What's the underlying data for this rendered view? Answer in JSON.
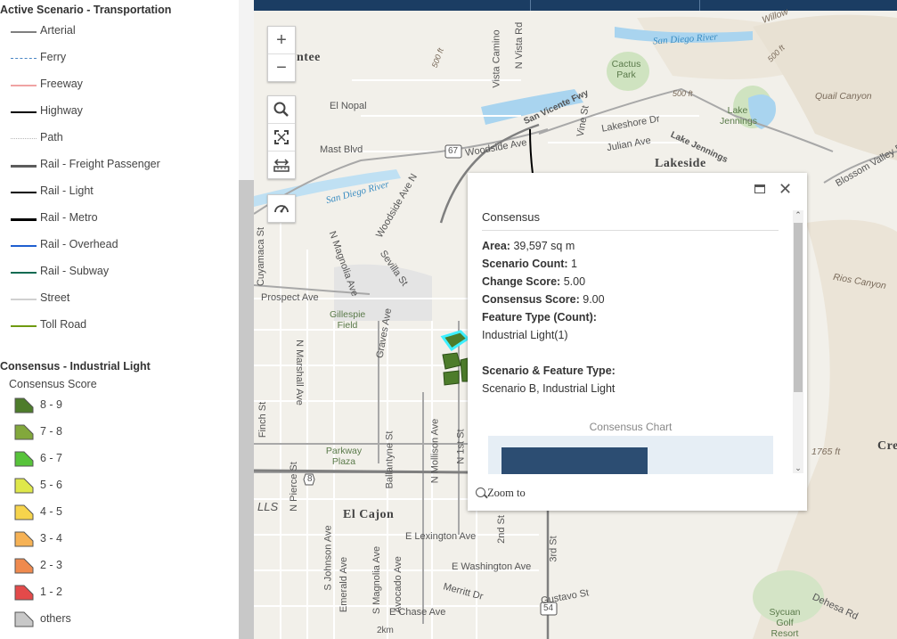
{
  "legend": {
    "transport_title": "Active Scenario - Transportation",
    "transport_items": [
      {
        "label": "Arterial",
        "color": "#7f7f7f",
        "style": "solid",
        "weight": 2
      },
      {
        "label": "Ferry",
        "color": "#4a86c5",
        "style": "dashed",
        "weight": 1.5
      },
      {
        "label": "Freeway",
        "color": "#f0a3a3",
        "style": "solid",
        "weight": 2
      },
      {
        "label": "Highway",
        "color": "#000000",
        "style": "solid",
        "weight": 2
      },
      {
        "label": "Path",
        "color": "#b7b7b7",
        "style": "dotted",
        "weight": 1.5
      },
      {
        "label": "Rail - Freight Passenger",
        "color": "#5c5c5c",
        "style": "solid",
        "weight": 3
      },
      {
        "label": "Rail - Light",
        "color": "#000000",
        "style": "solid",
        "weight": 2
      },
      {
        "label": "Rail - Metro",
        "color": "#000000",
        "style": "solid",
        "weight": 3
      },
      {
        "label": "Rail - Overhead",
        "color": "#1f5fd0",
        "style": "solid",
        "weight": 2
      },
      {
        "label": "Rail - Subway",
        "color": "#0e6b52",
        "style": "solid",
        "weight": 2
      },
      {
        "label": "Street",
        "color": "#d0d0d0",
        "style": "solid",
        "weight": 2
      },
      {
        "label": "Toll Road",
        "color": "#6f9a10",
        "style": "solid",
        "weight": 2
      }
    ],
    "consensus_title": "Consensus - Industrial Light",
    "consensus_subtitle": "Consensus Score",
    "consensus_items": [
      {
        "label": "8 - 9",
        "color": "#4d7c2b"
      },
      {
        "label": "7 - 8",
        "color": "#82a83c"
      },
      {
        "label": "6 - 7",
        "color": "#57c33a"
      },
      {
        "label": "5 - 6",
        "color": "#dfe84a"
      },
      {
        "label": "4 - 5",
        "color": "#f6d44c"
      },
      {
        "label": "3 - 4",
        "color": "#f6b255"
      },
      {
        "label": "2 - 3",
        "color": "#ef8a4e"
      },
      {
        "label": "1 - 2",
        "color": "#e34a4a"
      },
      {
        "label": "others",
        "color": "#c8c8c8"
      }
    ]
  },
  "map": {
    "controls": {
      "zoom_in": "+",
      "zoom_out": "−"
    },
    "labels": {
      "city_el_cajon": "El Cajon",
      "city_lakeside": "Lakeside",
      "city_santee_partial": "ntee",
      "city_cre_partial": "Cre",
      "water_san_diego_river_1": "San Diego River",
      "water_san_diego_river_2": "San Diego River",
      "park_cactus": "Cactus Park",
      "park_lake_jennings": "Lake Jennings",
      "park_gillespie": "Gillespie Field",
      "park_parkway_plaza": "Parkway Plaza",
      "park_sycuan": "Sycuan Golf Resort",
      "terrain_quail_canyon": "Quail Canyon",
      "terrain_rios_canyon": "Rios Canyon",
      "terrain_blossom_valley": "Blossom Valley Rd",
      "terrain_willow": "Willow",
      "terrain_1765": "1765 ft",
      "terrain_500_1": "500 ft",
      "terrain_500_2": "500 ft",
      "terrain_500_3": "500 ft",
      "street_el_nopal": "El Nopal",
      "street_mast": "Mast Blvd",
      "street_woodside": "Woodside Ave",
      "street_woodside_n": "Woodside Ave N",
      "street_lakeshore": "Lakeshore Dr",
      "street_julian": "Julian Ave",
      "street_san_vicente": "San Vicente Fwy",
      "street_lake_jennings": "Lake Jennings",
      "street_vista_camino": "Vista Camino",
      "street_n_vista": "N Vista Rd",
      "street_vine": "Vine St",
      "street_prospect": "Prospect Ave",
      "street_cuyamaca": "Cuyamaca St",
      "street_n_magnolia": "N Magnolia Ave",
      "street_sevilla": "Sevilla St",
      "street_graves": "Graves Ave",
      "street_n_marshall": "N Marshall Ave",
      "street_fincn": "Finch St",
      "street_n_pierce": "N Pierce St",
      "street_ballantyne": "Ballantyne St",
      "street_n_mollison": "N Mollison Ave",
      "street_n_1st": "N 1st St",
      "street_e_lexington": "E Lexington Ave",
      "street_e_washington": "E Washington Ave",
      "street_s_johnson": "S Johnson Ave",
      "street_emerald": "Emerald Ave",
      "street_s_magnolia": "S Magnolia Ave",
      "street_avocado": "Avocado Ave",
      "street_e_chase": "E Chase Ave",
      "street_merritt": "Merritt Dr",
      "street_gustavo": "Gustavo St",
      "street_2nd": "2nd St",
      "street_3rd": "3rd St",
      "street_dehesa": "Dehesa Rd",
      "street_2km": "2km",
      "shield_67": "67",
      "shield_8": "8",
      "shield_54": "54",
      "partial_lls": "LLS"
    }
  },
  "popup": {
    "title": "Consensus",
    "fields": [
      {
        "label": "Area:",
        "value": " 39,597 sq m"
      },
      {
        "label": "Scenario Count:",
        "value": " 1"
      },
      {
        "label": "Change Score:",
        "value": " 5.00"
      },
      {
        "label": "Consensus Score:",
        "value": " 9.00"
      },
      {
        "label": "Feature Type (Count):",
        "value": ""
      }
    ],
    "feature_type_value": "Industrial Light(1)",
    "scenario_label": "Scenario & Feature Type:",
    "scenario_value": "Scenario B, Industrial Light",
    "chart_title": "Consensus Chart",
    "zoom_to": "Zoom  to"
  },
  "chart_data": {
    "type": "bar",
    "title": "Consensus Chart",
    "categories": [
      ""
    ],
    "values": [
      9.0
    ],
    "xlim": [
      0,
      20
    ],
    "color": "#2c4d72"
  }
}
